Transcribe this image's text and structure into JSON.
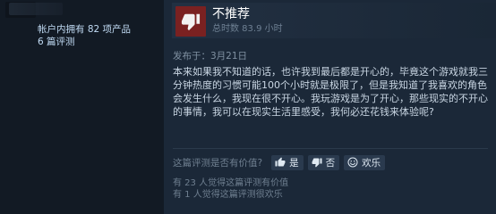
{
  "author": {
    "stats_line1": "帐户内拥有 82 项产品",
    "stats_line2": "6 篇评测"
  },
  "review": {
    "verdict": "不推荐",
    "hours": "总时数 83.9 小时",
    "posted": "发布于：3月21日",
    "body": "本来如果我不知道的话，也许我到最后都是开心的，毕竟这个游戏就我三分钟热度的习惯可能100个小时就是极限了，但是我知道了我喜欢的角色会发生什么，我现在很不开心。我玩游戏是为了开心，那些现实的不开心的事情，我可以在现实生活里感受，我何必还花钱来体验呢?",
    "helpful_question": "这篇评测是否有价值?",
    "vote_yes": "是",
    "vote_no": "否",
    "vote_funny": "欢乐",
    "helpful_count": "有 23 人觉得这篇评测有价值",
    "funny_count": "有 1 人觉得这篇评测很欢乐"
  },
  "colors": {
    "thumb_bg": "#7a2121",
    "accent": "#c1dbf4"
  },
  "icons": {
    "verdict": "thumbs-down-icon",
    "yes": "thumbs-up-icon",
    "no": "thumbs-down-icon",
    "funny": "smiley-icon"
  }
}
